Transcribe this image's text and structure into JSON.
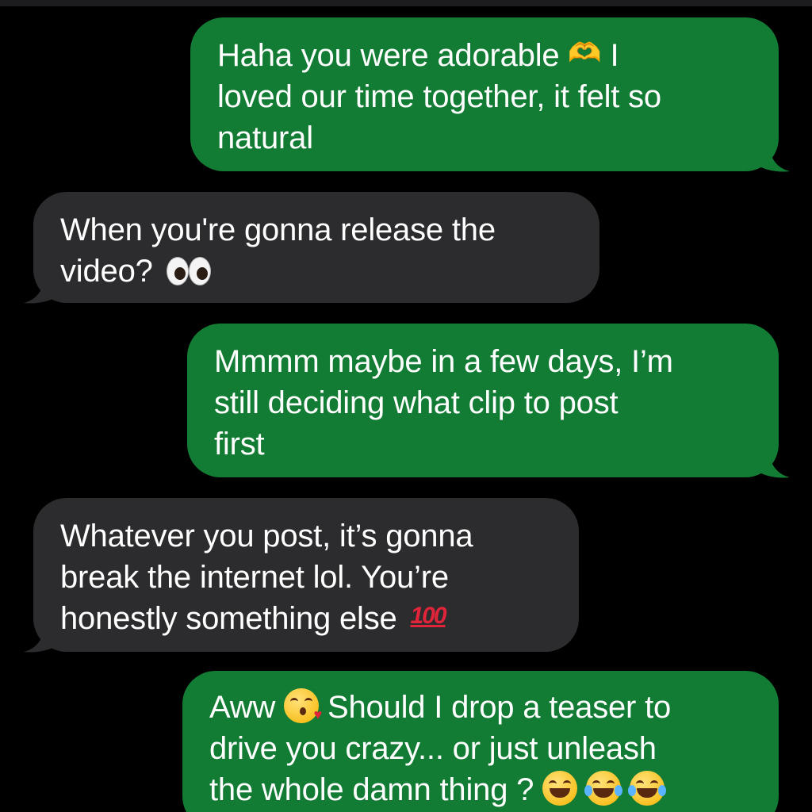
{
  "messages": [
    {
      "side": "sent",
      "line1": "Haha you were adorable",
      "line1b": "I",
      "line2": "loved our time together, it felt so",
      "line3": "natural",
      "emoji": "heart-hands-icon"
    },
    {
      "side": "received",
      "line1": "When you're gonna release the",
      "line2": "video?",
      "emoji": "eyes-icon"
    },
    {
      "side": "sent",
      "line1": "Mmmm maybe in a few days, I’m",
      "line2": "still deciding what clip to post",
      "line3": "first"
    },
    {
      "side": "received",
      "line1": "Whatever you post, it’s gonna",
      "line2": "break the internet lol. You’re",
      "line3": "honestly something else",
      "emoji": "hundred-points-icon",
      "emoji_text": "100"
    },
    {
      "side": "sent",
      "line1a": "Aww",
      "line1b": "Should I drop a teaser to",
      "line2": "drive you crazy... or just unleash",
      "line3": "the whole damn thing ?",
      "emojis": [
        "kissing-face-icon",
        "grinning-sweat-icon",
        "tears-of-joy-icon",
        "tears-of-joy-icon"
      ]
    }
  ],
  "colors": {
    "background": "#000000",
    "sent_bubble": "#127c34",
    "received_bubble": "#2c2c2e",
    "text": "#ffffff"
  }
}
